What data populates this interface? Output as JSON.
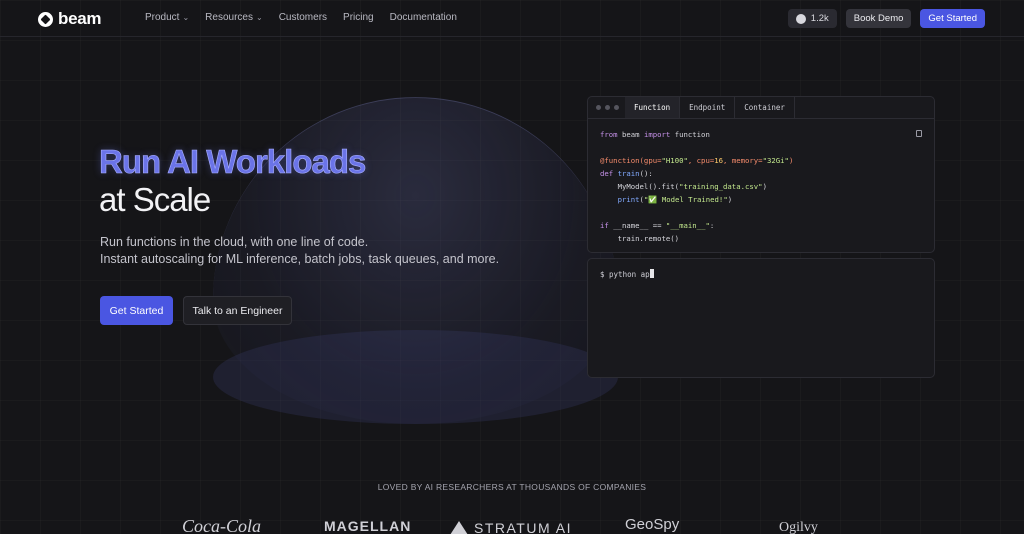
{
  "nav": {
    "logo_text": "beam",
    "links": [
      {
        "label": "Product",
        "dropdown": true
      },
      {
        "label": "Resources",
        "dropdown": true
      },
      {
        "label": "Customers",
        "dropdown": false
      },
      {
        "label": "Pricing",
        "dropdown": false
      },
      {
        "label": "Documentation",
        "dropdown": false
      }
    ],
    "github_stars": "1.2k",
    "book_demo": "Book Demo",
    "get_started": "Get Started"
  },
  "hero": {
    "title_line1": "Run AI Workloads",
    "title_line2": "at Scale",
    "subtitle_line1": "Run functions in the cloud, with one line of code.",
    "subtitle_line2": "Instant autoscaling for ML inference, batch jobs, task queues, and more.",
    "cta_primary": "Get Started",
    "cta_secondary": "Talk to an Engineer"
  },
  "code_panel": {
    "tabs": [
      "Function",
      "Endpoint",
      "Container"
    ],
    "active_tab": "Function",
    "terminal_prompt": "$ python ap"
  },
  "social_proof": {
    "heading": "LOVED BY AI RESEARCHERS AT THOUSANDS OF COMPANIES",
    "logos": [
      "Coca-Cola",
      "MAGELLAN",
      "STRATUM AI",
      "GeoSpy",
      "Ogilvy"
    ]
  },
  "colors": {
    "background": "#151518",
    "accent": "#4a56e2",
    "title_accent": "#6b74e8"
  }
}
